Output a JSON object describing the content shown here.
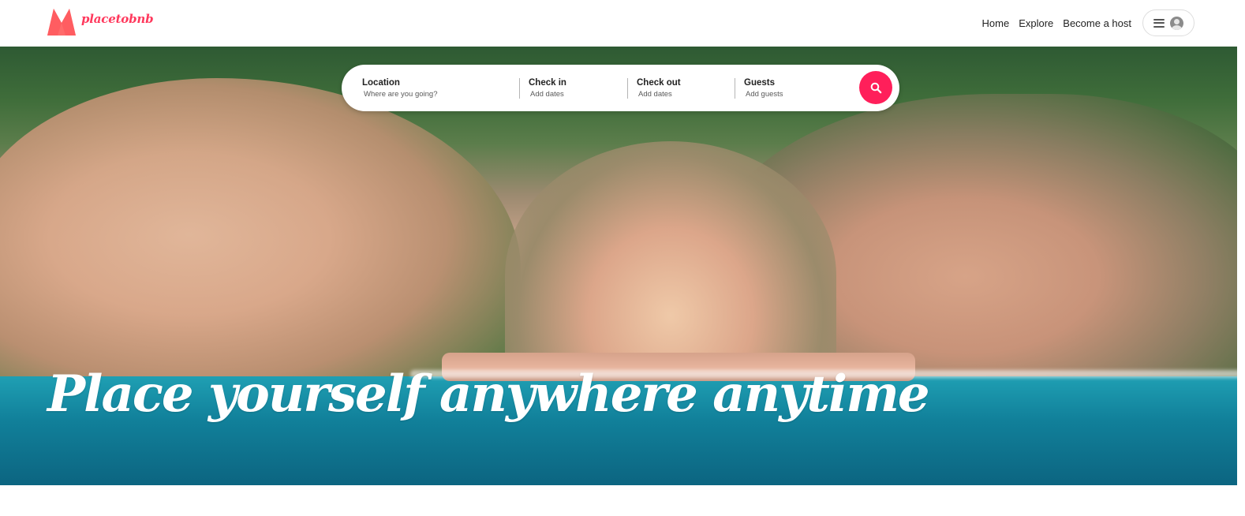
{
  "brand": {
    "name": "placetobnb",
    "color": "#ff385c"
  },
  "nav": {
    "links": [
      "Home",
      "Explore",
      "Become a host"
    ],
    "menu_icon": "hamburger-icon",
    "avatar_icon": "user-avatar-icon"
  },
  "search": {
    "location": {
      "label": "Location",
      "placeholder": "Where are you going?"
    },
    "checkin": {
      "label": "Check in",
      "placeholder": "Add dates"
    },
    "checkout": {
      "label": "Check out",
      "placeholder": "Add dates"
    },
    "guests": {
      "label": "Guests",
      "placeholder": "Add guests"
    },
    "button_icon": "search-icon",
    "button_color": "#ff1f5a"
  },
  "hero": {
    "headline": "Place yourself anywhere anytime"
  }
}
